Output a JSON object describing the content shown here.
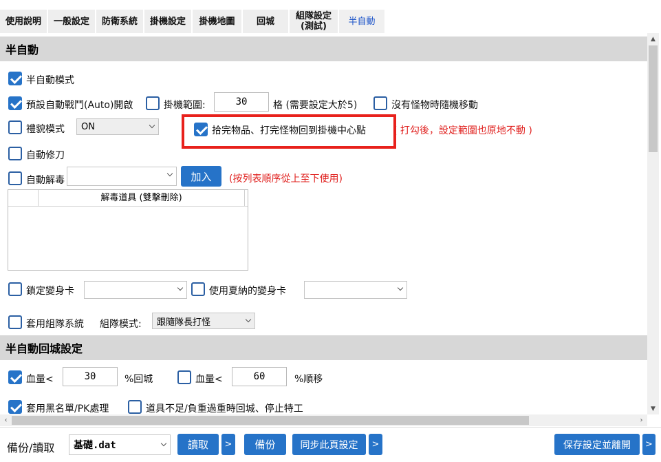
{
  "tabs": [
    "使用說明",
    "一般設定",
    "防衛系統",
    "掛機設定",
    "掛機地圖",
    "回城",
    "組隊設定\n(測試)",
    "半自動"
  ],
  "section_semi_auto": "半自動",
  "semi_auto_mode": "半自動模式",
  "default_auto_battle": "預設自動戰鬥(Auto)開啟",
  "hang_range_label": "掛機範圍:",
  "hang_range_value": "30",
  "hang_range_hint": "格 (需要設定大於5)",
  "random_move": "沒有怪物時隨機移動",
  "etiquette_mode": "禮貌模式",
  "etiquette_value": "ON",
  "return_center": "拾完物品、打完怪物回到掛機中心點",
  "return_center_note": "( 打勾後，設定範圍也原地不動 )",
  "auto_repair": "自動修刀",
  "auto_detox": "自動解毒",
  "add_button": "加入",
  "list_order_note": "(按列表順序從上至下使用)",
  "detox_list_header": "解毒道具 (雙擊刪除)",
  "lock_transform": "鎖定變身卡",
  "use_xia_transform": "使用夏納的變身卡",
  "use_party_system": "套用組隊系統",
  "party_mode_label": "組隊模式:",
  "party_mode_value": "跟隨隊長打怪",
  "section_return": "半自動回城設定",
  "hp_label_1": "血量<",
  "hp_value_1": "30",
  "hp_suffix_1": "%回城",
  "hp_label_2": "血量<",
  "hp_value_2": "60",
  "hp_suffix_2": "%順移",
  "blacklist_pk": "套用黑名單/PK處理",
  "item_shortage": "道具不足/負重過重時回城、停止特工",
  "bottom": {
    "backup_read_label": "備份/讀取",
    "file_value": "基礎.dat",
    "read_button": "讀取",
    "more_1": ">",
    "backup_button": "備份",
    "sync_button": "同步此頁設定",
    "more_2": ">",
    "save_exit_button": "保存設定並離開",
    "more_3": ">"
  },
  "colors": {
    "accent": "#2673c8",
    "highlight_red": "#e8211c",
    "section_bg": "#d7d7d7"
  }
}
